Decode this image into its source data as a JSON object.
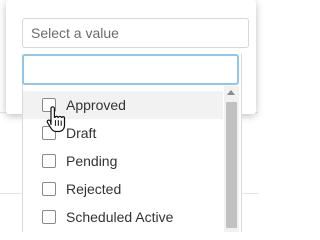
{
  "select": {
    "placeholder": "Select a value"
  },
  "search": {
    "value": "",
    "placeholder": ""
  },
  "options": [
    {
      "label": "Approved",
      "checked": false,
      "hovered": true
    },
    {
      "label": "Draft",
      "checked": false,
      "hovered": false
    },
    {
      "label": "Pending",
      "checked": false,
      "hovered": false
    },
    {
      "label": "Rejected",
      "checked": false,
      "hovered": false
    },
    {
      "label": "Scheduled Active",
      "checked": false,
      "hovered": false
    }
  ],
  "colors": {
    "focus_border": "#8ec5f2",
    "hover_bg": "#f2f2f2",
    "scroll_thumb": "#c1c1c1"
  },
  "icons": {
    "cursor": "hand-pointer-icon",
    "scroll_up": "scroll-up-arrow-icon"
  }
}
